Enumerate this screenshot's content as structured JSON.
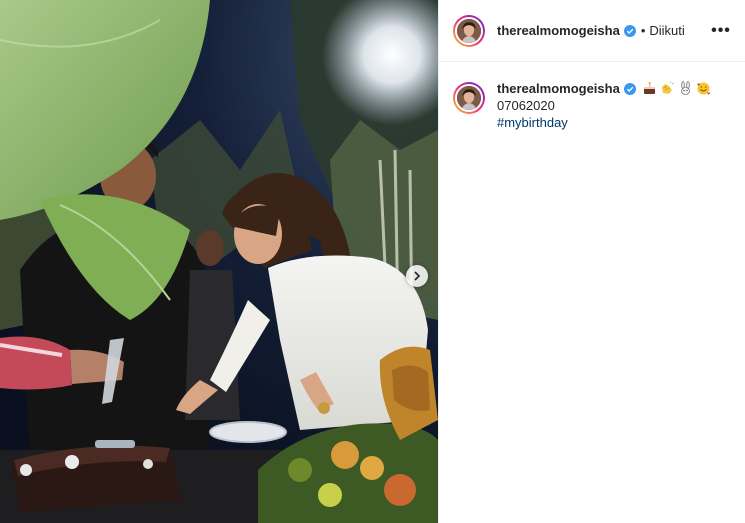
{
  "post": {
    "username": "therealmomogeisha",
    "follow_status": "Diikuti",
    "separator": "•",
    "more_label": "•••",
    "caption": {
      "emojis": [
        "cake-emoji",
        "clapping-hands-emoji",
        "rabbit-emoji",
        "smiling-face-with-hearts-emoji"
      ],
      "date_text": "07062020",
      "hashtag": "#mybirthday"
    }
  },
  "colors": {
    "verified": "#3897f0",
    "hashtag": "#00376b",
    "ring_start": "#f9ce34",
    "ring_mid": "#ee2a7b",
    "ring_end": "#6228d7"
  }
}
